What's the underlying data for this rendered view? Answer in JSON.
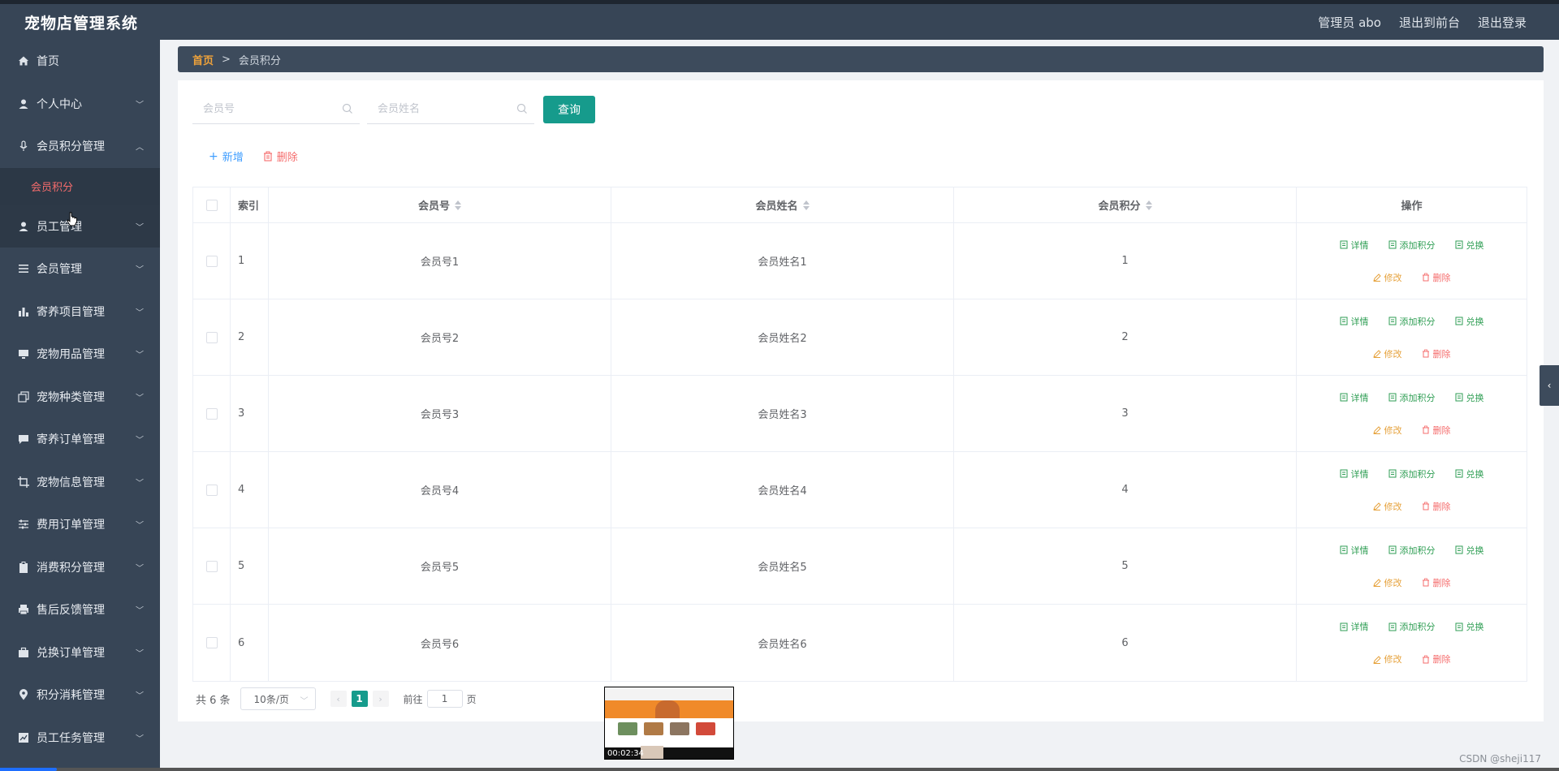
{
  "app": {
    "title": "宠物店管理系统"
  },
  "header": {
    "user": "管理员 abo",
    "to_front": "退出到前台",
    "logout": "退出登录"
  },
  "sidebar": {
    "items": [
      {
        "label": "首页",
        "icon": "home-icon"
      },
      {
        "label": "个人中心",
        "icon": "user-icon"
      },
      {
        "label": "会员积分管理",
        "icon": "mic-icon"
      },
      {
        "label": "员工管理",
        "icon": "user-icon"
      },
      {
        "label": "会员管理",
        "icon": "list-icon"
      },
      {
        "label": "寄养项目管理",
        "icon": "bar-chart-icon"
      },
      {
        "label": "宠物用品管理",
        "icon": "monitor-icon"
      },
      {
        "label": "宠物种类管理",
        "icon": "copy-icon"
      },
      {
        "label": "寄养订单管理",
        "icon": "message-icon"
      },
      {
        "label": "宠物信息管理",
        "icon": "crop-icon"
      },
      {
        "label": "费用订单管理",
        "icon": "sliders-icon"
      },
      {
        "label": "消费积分管理",
        "icon": "clipboard-icon"
      },
      {
        "label": "售后反馈管理",
        "icon": "printer-icon"
      },
      {
        "label": "兑换订单管理",
        "icon": "briefcase-icon"
      },
      {
        "label": "积分消耗管理",
        "icon": "location-icon"
      },
      {
        "label": "员工任务管理",
        "icon": "chart-icon"
      }
    ],
    "submenu_active": "会员积分"
  },
  "breadcrumb": {
    "home": "首页",
    "sep": ">",
    "current": "会员积分"
  },
  "search": {
    "member_no_placeholder": "会员号",
    "member_name_placeholder": "会员姓名",
    "query_label": "查询"
  },
  "actions": {
    "add": "新增",
    "delete": "删除"
  },
  "table": {
    "headers": {
      "index": "索引",
      "member_no": "会员号",
      "member_name": "会员姓名",
      "points": "会员积分",
      "ops": "操作"
    },
    "ops": {
      "detail": "详情",
      "add_points": "添加积分",
      "exchange": "兑换",
      "edit": "修改",
      "delete": "删除"
    },
    "rows": [
      {
        "index": "1",
        "member_no": "会员号1",
        "member_name": "会员姓名1",
        "points": "1"
      },
      {
        "index": "2",
        "member_no": "会员号2",
        "member_name": "会员姓名2",
        "points": "2"
      },
      {
        "index": "3",
        "member_no": "会员号3",
        "member_name": "会员姓名3",
        "points": "3"
      },
      {
        "index": "4",
        "member_no": "会员号4",
        "member_name": "会员姓名4",
        "points": "4"
      },
      {
        "index": "5",
        "member_no": "会员号5",
        "member_name": "会员姓名5",
        "points": "5"
      },
      {
        "index": "6",
        "member_no": "会员号6",
        "member_name": "会员姓名6",
        "points": "6"
      }
    ]
  },
  "pagination": {
    "total": "共 6 条",
    "page_size": "10条/页",
    "current_page": "1",
    "goto_label": "前往",
    "goto_value": "1",
    "page_suffix": "页"
  },
  "video": {
    "time": "00:02:34"
  },
  "watermark": "CSDN @sheji117",
  "colors": {
    "sidebar_bg": "#374556",
    "accent": "#169b8c",
    "active_sub": "#f56c6c",
    "breadcrumb_home": "#f0a33a"
  }
}
